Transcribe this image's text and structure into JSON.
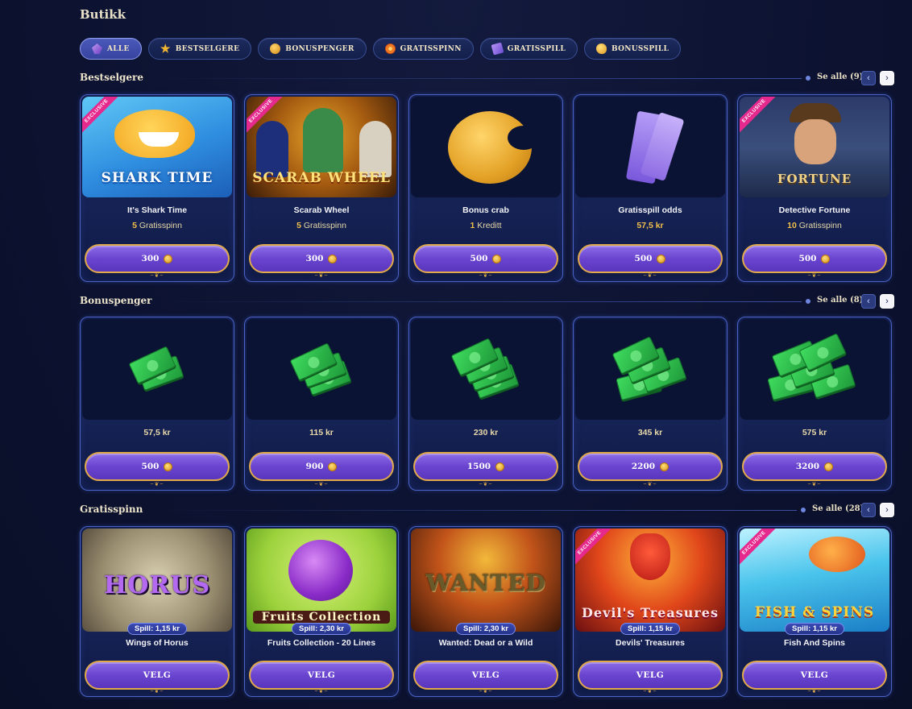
{
  "page_title": "Butikk",
  "filters": [
    {
      "label": "ALLE",
      "icon": "crystal-icon",
      "active": true
    },
    {
      "label": "BESTSELGERE",
      "icon": "star-icon",
      "active": false
    },
    {
      "label": "BONUSPENGER",
      "icon": "coin-icon",
      "active": false
    },
    {
      "label": "GRATISSPINN",
      "icon": "spin-icon",
      "active": false
    },
    {
      "label": "GRATISSPILL",
      "icon": "ticket-icon",
      "active": false
    },
    {
      "label": "BONUSSPILL",
      "icon": "gold-coin-icon",
      "active": false
    }
  ],
  "sections": {
    "bestselgere": {
      "title": "Bestselgere",
      "see_all": "Se alle (9)",
      "cards": [
        {
          "name": "It's Shark Time",
          "sub_num": "5",
          "sub_text": "Gratisspinn",
          "price": "300",
          "exclusive": "EXCLUSIVE",
          "logo": "SHARK TIME"
        },
        {
          "name": "Scarab Wheel",
          "sub_num": "5",
          "sub_text": "Gratisspinn",
          "price": "300",
          "exclusive": "EXCLUSIVE",
          "logo": "SCARAB WHEEL"
        },
        {
          "name": "Bonus crab",
          "sub_num": "1",
          "sub_text": "Kreditt",
          "price": "500"
        },
        {
          "name": "Gratisspill odds",
          "sub_num": "57,5 kr",
          "sub_text": "",
          "price": "500"
        },
        {
          "name": "Detective Fortune",
          "sub_num": "10",
          "sub_text": "Gratisspinn",
          "price": "500",
          "exclusive": "EXCLUSIVE",
          "logo": "FORTUNE"
        }
      ]
    },
    "bonuspenger": {
      "title": "Bonuspenger",
      "see_all": "Se alle (8)",
      "cards": [
        {
          "name": "57,5 kr",
          "price": "500"
        },
        {
          "name": "115 kr",
          "price": "900"
        },
        {
          "name": "230 kr",
          "price": "1500"
        },
        {
          "name": "345 kr",
          "price": "2200"
        },
        {
          "name": "575 kr",
          "price": "3200"
        }
      ]
    },
    "gratisspinn": {
      "title": "Gratisspinn",
      "see_all": "Se alle (28)",
      "cards": [
        {
          "name": "Wings of Horus",
          "tag": "Spill: 1,15 kr",
          "button": "VELG",
          "logo": "HORUS"
        },
        {
          "name": "Fruits Collection - 20 Lines",
          "tag": "Spill: 2,30 kr",
          "button": "VELG",
          "logo": "Fruits Collection"
        },
        {
          "name": "Wanted: Dead or a Wild",
          "tag": "Spill: 2,30 kr",
          "button": "VELG",
          "logo": "WANTED"
        },
        {
          "name": "Devils' Treasures",
          "tag": "Spill: 1,15 kr",
          "button": "VELG",
          "exclusive": "EXCLUSIVE",
          "logo": "Devil's Treasures"
        },
        {
          "name": "Fish And Spins",
          "tag": "Spill: 1,15 kr",
          "button": "VELG",
          "exclusive": "EXCLUSIVE",
          "logo": "FISH & SPINS"
        }
      ]
    }
  },
  "colors": {
    "background": "#0d1330",
    "card_border": "#4a63c4",
    "button_purple": "#6a44cf",
    "button_border": "#e1a94a",
    "accent_gold": "#f2c04a"
  }
}
